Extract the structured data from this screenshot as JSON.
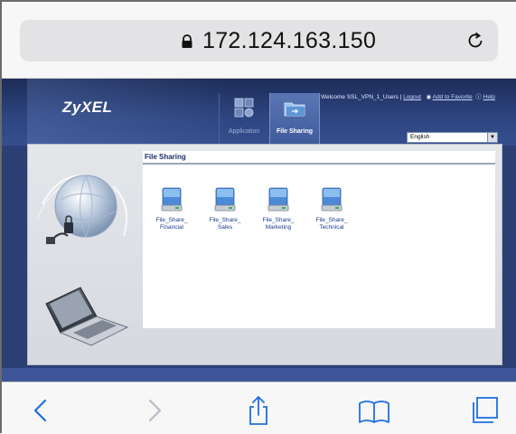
{
  "browser": {
    "url": "172.124.163.150",
    "icons": {
      "lock": "lock-icon",
      "reload": "reload-icon",
      "back": "back-icon",
      "forward": "forward-icon",
      "share": "share-icon",
      "bookmarks": "bookmarks-icon",
      "tabs": "tabs-icon"
    },
    "accent_color": "#1f6fe0"
  },
  "header": {
    "logo": "ZyXEL",
    "tabs": [
      {
        "label": "Application",
        "active": false
      },
      {
        "label": "File Sharing",
        "active": true
      }
    ],
    "welcome_text": "Welcome SSL_VPN_1_Users |",
    "logout_label": "Logout",
    "favorite_label": "Add to Favorite",
    "help_label": "Help",
    "language": "English"
  },
  "main": {
    "title": "File Sharing",
    "shares": [
      {
        "line1": "File_Share_",
        "line2": "Financial"
      },
      {
        "line1": "File_Share_",
        "line2": "Sales"
      },
      {
        "line1": "File_Share_",
        "line2": "Marketing"
      },
      {
        "line1": "File_Share_",
        "line2": "Technical"
      }
    ]
  },
  "colors": {
    "header_dark": "#1d2c58",
    "header_mid": "#2d4480",
    "link_blue": "#1b3a8a"
  }
}
